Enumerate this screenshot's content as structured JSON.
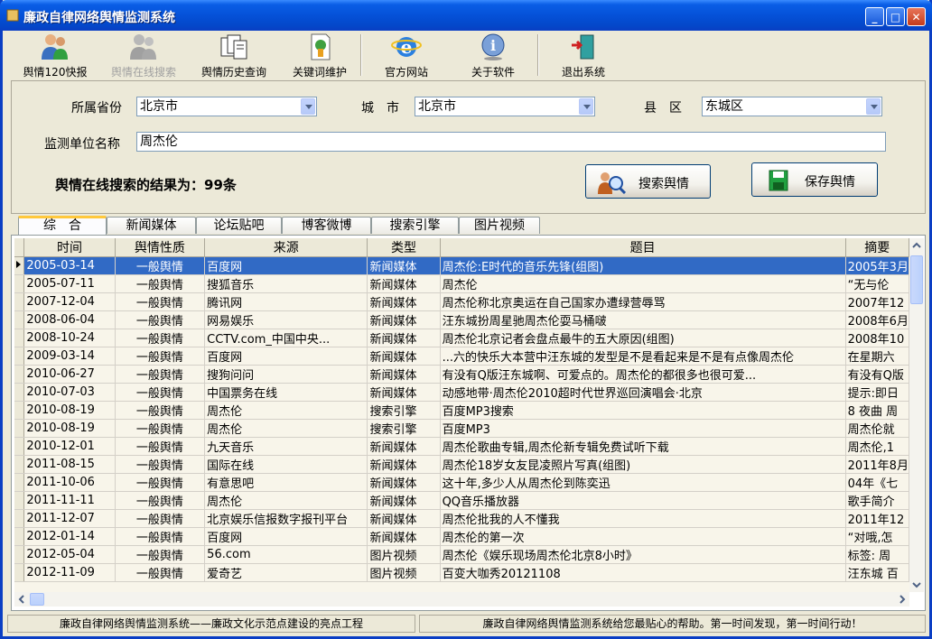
{
  "window": {
    "title": "廉政自律网络舆情监测系统"
  },
  "toolbar": {
    "items": [
      {
        "label": "舆情120快报",
        "icon": "users-icon",
        "enabled": true
      },
      {
        "label": "舆情在线搜索",
        "icon": "users-online-icon",
        "enabled": false
      },
      {
        "label": "舆情历史查询",
        "icon": "documents-icon",
        "enabled": true
      },
      {
        "label": "关键词维护",
        "icon": "key-document-icon",
        "enabled": true
      },
      {
        "label": "官方网站",
        "icon": "ie-icon",
        "enabled": true
      },
      {
        "label": "关于软件",
        "icon": "info-icon",
        "enabled": true
      },
      {
        "label": "退出系统",
        "icon": "exit-door-icon",
        "enabled": true
      }
    ]
  },
  "filter": {
    "province_label": "所属省份",
    "province_value": "北京市",
    "city_label": "城　市",
    "city_value": "北京市",
    "county_label": "县　区",
    "county_value": "东城区",
    "unit_label": "监测单位名称",
    "unit_value": "周杰伦",
    "result_text": "舆情在线搜索的结果为：99条",
    "search_button": "搜索舆情",
    "save_button": "保存舆情"
  },
  "tabs": [
    "综　合",
    "新闻媒体",
    "论坛贴吧",
    "博客微博",
    "搜索引擎",
    "图片视频"
  ],
  "table": {
    "columns": [
      "时间",
      "舆情性质",
      "来源",
      "类型",
      "题目",
      "摘要"
    ],
    "rows": [
      [
        "2005-03-14",
        "一般舆情",
        "百度网",
        "新闻媒体",
        "周杰伦:E时代的音乐先锋(组图)",
        "2005年3月"
      ],
      [
        "2005-07-11",
        "一般舆情",
        "搜狐音乐",
        "新闻媒体",
        "周杰伦",
        "“无与伦"
      ],
      [
        "2007-12-04",
        "一般舆情",
        "腾讯网",
        "新闻媒体",
        "周杰伦称北京奥运在自己国家办遭绿营辱骂",
        "2007年12"
      ],
      [
        "2008-06-04",
        "一般舆情",
        "网易娱乐",
        "新闻媒体",
        "汪东城扮周星驰周杰伦耍马桶啵",
        "2008年6月"
      ],
      [
        "2008-10-24",
        "一般舆情",
        "CCTV.com_中国中央...",
        "新闻媒体",
        "周杰伦北京记者会盘点最牛的五大原因(组图)",
        "2008年10"
      ],
      [
        "2009-03-14",
        "一般舆情",
        "百度网",
        "新闻媒体",
        "...六的快乐大本营中汪东城的发型是不是看起来是不是有点像周杰伦",
        "在星期六"
      ],
      [
        "2010-06-27",
        "一般舆情",
        "搜狗问问",
        "新闻媒体",
        "有没有Q版汪东城啊、可爱点的。周杰伦的都很多也很可爱...",
        "有没有Q版"
      ],
      [
        "2010-07-03",
        "一般舆情",
        "中国票务在线",
        "新闻媒体",
        "动感地带·周杰伦2010超时代世界巡回演唱会·北京",
        "提示:即日"
      ],
      [
        "2010-08-19",
        "一般舆情",
        "周杰伦",
        "搜索引擎",
        "百度MP3搜索",
        "8 夜曲 周"
      ],
      [
        "2010-08-19",
        "一般舆情",
        "周杰伦",
        "搜索引擎",
        "百度MP3",
        "周杰伦就"
      ],
      [
        "2010-12-01",
        "一般舆情",
        "九天音乐",
        "新闻媒体",
        "周杰伦歌曲专辑,周杰伦新专辑免费试听下载",
        "周杰伦,1"
      ],
      [
        "2011-08-15",
        "一般舆情",
        "国际在线",
        "新闻媒体",
        "周杰伦18岁女友昆凌照片写真(组图)",
        "2011年8月"
      ],
      [
        "2011-10-06",
        "一般舆情",
        "有意思吧",
        "新闻媒体",
        "这十年,多少人从周杰伦到陈奕迅",
        "04年《七"
      ],
      [
        "2011-11-11",
        "一般舆情",
        "周杰伦",
        "新闻媒体",
        "QQ音乐播放器",
        "歌手简介"
      ],
      [
        "2011-12-07",
        "一般舆情",
        "北京娱乐信报数字报刊平台",
        "新闻媒体",
        "周杰伦批我的人不懂我",
        "2011年12"
      ],
      [
        "2012-01-14",
        "一般舆情",
        "百度网",
        "新闻媒体",
        "周杰伦的第一次",
        "“对哦,怎"
      ],
      [
        "2012-05-04",
        "一般舆情",
        "56.com",
        "图片视频",
        "周杰伦《娱乐现场周杰伦北京8小时》",
        "标签: 周"
      ],
      [
        "2012-11-09",
        "一般舆情",
        "爱奇艺",
        "图片视频",
        "百变大咖秀20121108",
        "汪东城 百"
      ]
    ]
  },
  "status": {
    "left": "廉政自律网络舆情监测系统——廉政文化示范点建设的亮点工程",
    "right": "廉政自律网络舆情监测系统给您最贴心的帮助。第一时间发现，第一时间行动！"
  }
}
